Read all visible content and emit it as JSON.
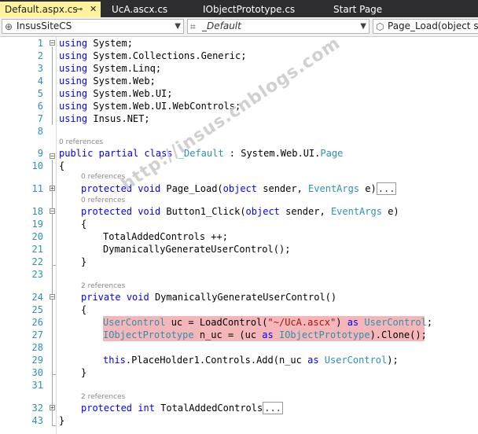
{
  "tabs": [
    {
      "label": "Default.aspx.cs",
      "active": true
    },
    {
      "label": "UcA.ascx.cs"
    },
    {
      "label": "IObjectPrototype.cs"
    },
    {
      "label": "Start Page"
    }
  ],
  "icons": {
    "pin": "pin-icon",
    "close": "close-icon",
    "project": "csharp-project-icon",
    "method": "method-icon"
  },
  "navbar": {
    "project": "InsusSiteCS",
    "class": "_Default",
    "member": "Page_Load(object se"
  },
  "refs": {
    "zero": "0 references",
    "two": "2 references"
  },
  "watermark": "http://insus.cnblogs.com",
  "lines": {
    "l1": "1",
    "l2": "2",
    "l3": "3",
    "l4": "4",
    "l5": "5",
    "l6": "6",
    "l7": "7",
    "l8": "8",
    "l9": "9",
    "l10": "10",
    "l11": "11",
    "l18": "18",
    "l19": "19",
    "l20": "20",
    "l21": "21",
    "l22": "22",
    "l23": "23",
    "l24": "24",
    "l25": "25",
    "l26": "26",
    "l27": "27",
    "l28": "28",
    "l29": "29",
    "l30": "30",
    "l31": "31",
    "l32": "32",
    "l43": "43"
  },
  "code": {
    "using": "using",
    "ns1": " System;",
    "ns2": " System.Collections.Generic;",
    "ns3": " System.Linq;",
    "ns4": " System.Web;",
    "ns5": " System.Web.UI;",
    "ns6": " System.Web.UI.WebControls;",
    "ns7": " Insus.NET;",
    "public": "public",
    "partial": "partial",
    "class": "class",
    "className": "_Default",
    "colon": " : System.Web.UI.",
    "page": "Page",
    "openBrace": "{",
    "closeBrace": "}",
    "protected": "protected",
    "void": "void",
    "pageLoad": " Page_Load(",
    "object": "object",
    "sender": " sender, ",
    "eventArgs": "EventArgs",
    "eParen": " e)",
    "ellipsis": "...",
    "button1": " Button1_Click(",
    "totalAdded": "TotalAddedControls ++;",
    "dynCall": "DymanicallyGenerateUserControl();",
    "private": "private",
    "dynDecl": " DymanicallyGenerateUserControl()",
    "userControl": "UserControl",
    "ucAssign": " uc = LoadControl(",
    "ucPath": "\"~/UcA.ascx\"",
    "closeParen": ")",
    "as": "as",
    "semi": ";",
    "iobj": "IObjectPrototype",
    "nucAssign": " n_uc = (uc ",
    "clone": ").Clone();",
    "this": "this",
    "placeholder": ".PlaceHolder1.Controls.Add(n_uc ",
    "closeSemi": ");",
    "int": "int",
    "totalProp": " TotalAddedControls"
  }
}
